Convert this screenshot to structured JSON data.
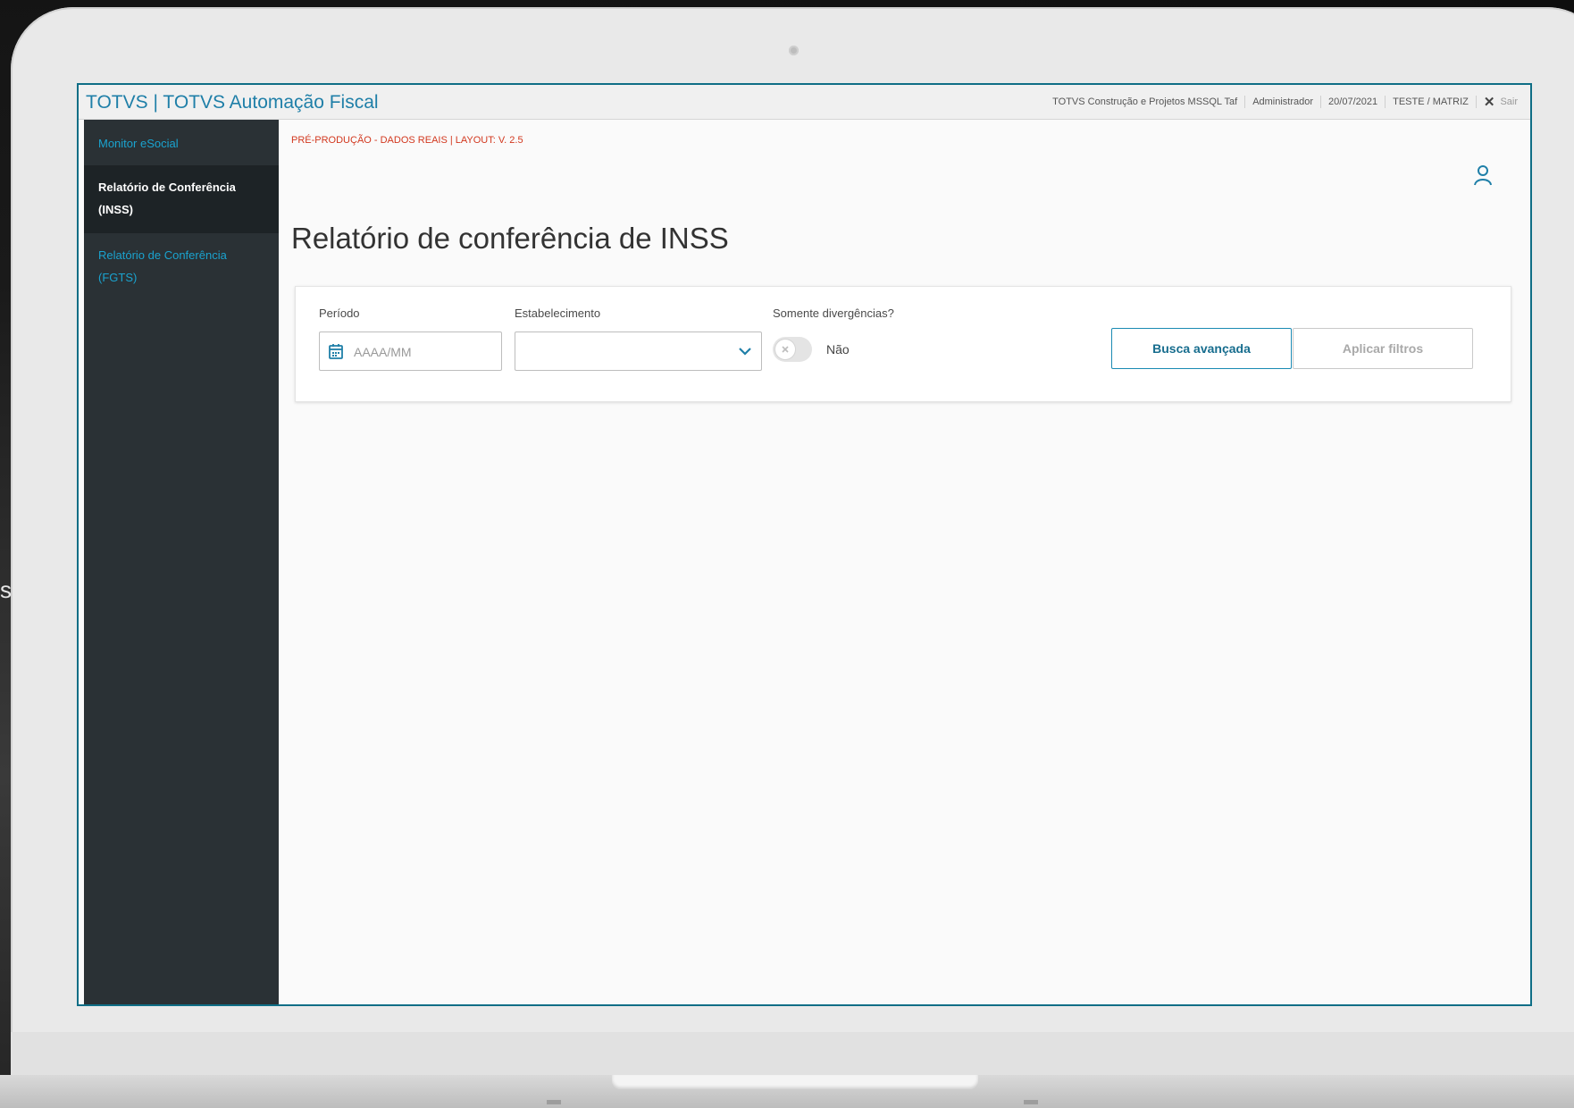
{
  "background": {
    "partial_letter": "s"
  },
  "header": {
    "app_title": "TOTVS | TOTVS Automação Fiscal",
    "company": "TOTVS Construção e Projetos MSSQL Taf",
    "user": "Administrador",
    "date": "20/07/2021",
    "branch": "TESTE / MATRIZ",
    "exit_label": "Sair"
  },
  "sidebar": {
    "items": [
      {
        "label": "Monitor eSocial",
        "active": false
      },
      {
        "label": "Relatório de Conferência (INSS)",
        "active": true
      },
      {
        "label": "Relatório de Conferência (FGTS)",
        "active": false
      }
    ]
  },
  "main": {
    "environment_banner": "PRÉ-PRODUÇÃO - DADOS REAIS | LAYOUT: V. 2.5",
    "title": "Relatório de conferência de INSS"
  },
  "filters": {
    "period_label": "Período",
    "period_placeholder": "AAAA/MM",
    "establishment_label": "Estabelecimento",
    "establishment_value": "",
    "divergences_label": "Somente divergências?",
    "divergences_value": "Não",
    "advanced_search_label": "Busca avançada",
    "apply_filters_label": "Aplicar filtros"
  },
  "colors": {
    "accent": "#1f7fa8",
    "sidebar_bg": "#2a3135",
    "banner": "#d2381f"
  }
}
